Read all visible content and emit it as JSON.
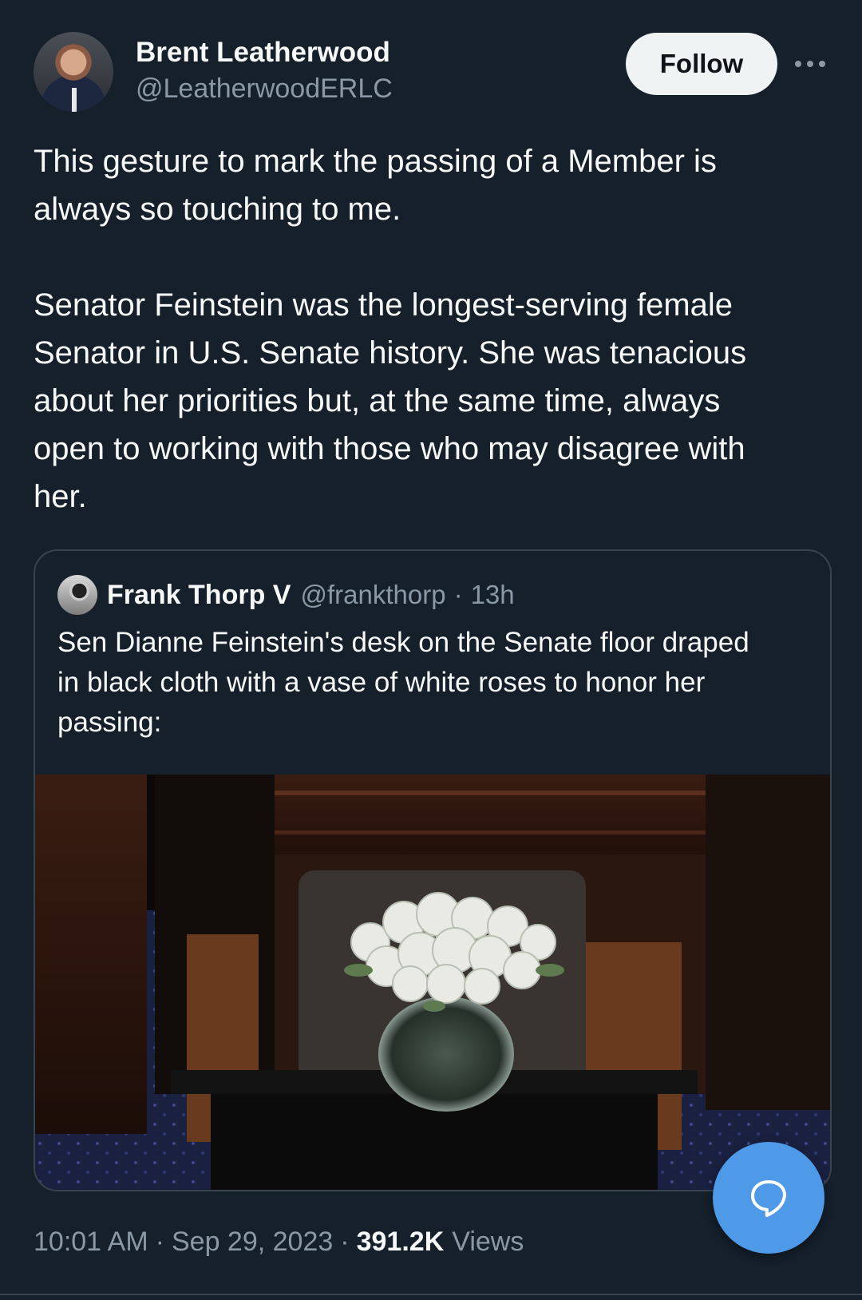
{
  "author": {
    "name": "Brent Leatherwood",
    "handle": "@LeatherwoodERLC",
    "follow_label": "Follow",
    "more_icon": "more-icon"
  },
  "tweet": {
    "paragraphs": [
      "This gesture to mark the passing of a Member is\nalways so touching to me.",
      "Senator Feinstein was the longest-serving female\nSenator in U.S. Senate history. She was tenacious\nabout her priorities but, at the same time, always\nopen to working with those who may disagree with\nher."
    ]
  },
  "quote": {
    "name": "Frank Thorp V",
    "handle": "@frankthorp",
    "separator": "·",
    "time": "13h",
    "text": "Sen Dianne Feinstein's desk on the Senate floor draped\nin black cloth with a vase of white roses to honor her\npassing:"
  },
  "meta": {
    "time": "10:01 AM",
    "separator": "·",
    "date": "Sep 29, 2023",
    "views_count": "391.2K",
    "views_label": "Views"
  },
  "fab": {
    "icon": "reply-bubble-icon"
  },
  "colors": {
    "background": "#15202b",
    "text": "#f7f9f9",
    "muted": "#8b98a5",
    "border": "#38444d",
    "accent": "#4f9ae8"
  }
}
